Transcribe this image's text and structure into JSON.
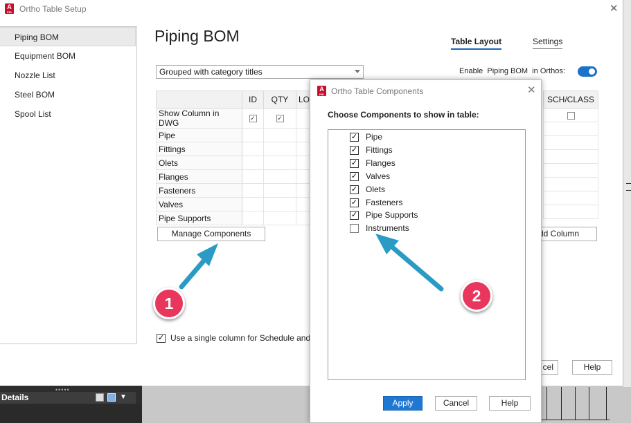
{
  "window": {
    "title": "Ortho Table Setup"
  },
  "nav": {
    "items": [
      "Piping BOM",
      "Equipment BOM",
      "Nozzle List",
      "Steel BOM",
      "Spool List"
    ]
  },
  "page": {
    "title": "Piping BOM"
  },
  "tabs": {
    "layout": "Table Layout",
    "settings": "Settings"
  },
  "grouping": {
    "selected": "Grouped with category titles"
  },
  "enable": {
    "prefix": "Enable",
    "name": "Piping BOM",
    "suffix": "in Orthos:"
  },
  "grid": {
    "columns": [
      "ID",
      "QTY",
      "LO"
    ],
    "right_column": "SCH/CLASS",
    "rows": [
      "Show Column in DWG",
      "Pipe",
      "Fittings",
      "Olets",
      "Flanges",
      "Fasteners",
      "Valves",
      "Pipe Supports"
    ]
  },
  "buttons": {
    "manage": "Manage Components",
    "add_column": "dd Column",
    "cancel_partial": "cel",
    "help": "Help"
  },
  "single_column": {
    "label": "Use a single column for Schedule and"
  },
  "modal": {
    "title": "Ortho Table Components",
    "instruction": "Choose Components to show in table:",
    "components": [
      {
        "label": "Pipe",
        "checked": true
      },
      {
        "label": "Fittings",
        "checked": true
      },
      {
        "label": "Flanges",
        "checked": true
      },
      {
        "label": "Valves",
        "checked": true
      },
      {
        "label": "Olets",
        "checked": true
      },
      {
        "label": "Fasteners",
        "checked": true
      },
      {
        "label": "Pipe Supports",
        "checked": true
      },
      {
        "label": "Instruments",
        "checked": false
      }
    ],
    "apply": "Apply",
    "cancel": "Cancel",
    "help": "Help"
  },
  "details": {
    "title": "Details"
  },
  "annotations": {
    "one": "1",
    "two": "2",
    "color": "#e8365d",
    "arrow_color": "#2a9bc4"
  }
}
